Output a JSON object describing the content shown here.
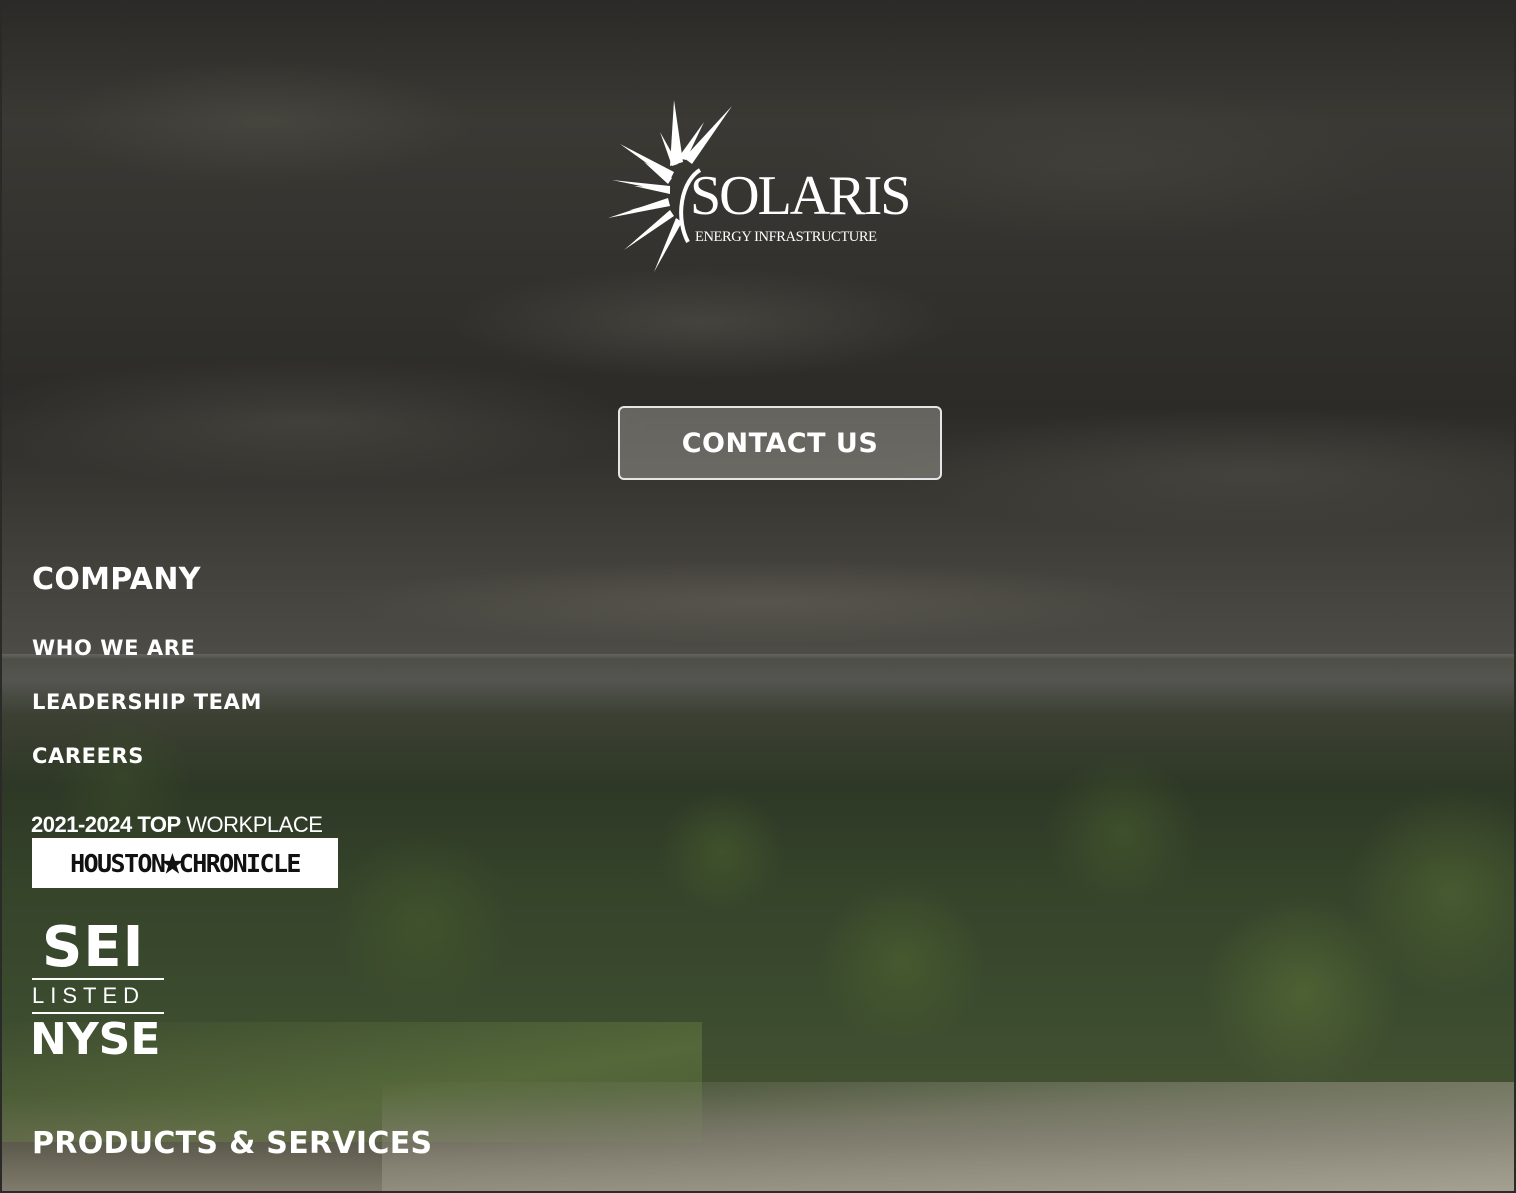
{
  "brand": {
    "name": "SOLARIS",
    "trademark": "™",
    "tagline": "ENERGY INFRASTRUCTURE"
  },
  "cta": {
    "contact_label": "CONTACT US"
  },
  "company": {
    "heading": "COMPANY",
    "links": [
      {
        "label": "WHO WE ARE"
      },
      {
        "label": "LEADERSHIP TEAM"
      },
      {
        "label": "CAREERS"
      }
    ]
  },
  "award": {
    "years": "2021-2024",
    "top": "TOP",
    "workplace": "WORKPLACE",
    "publisher_left": "HOUSTON",
    "publisher_right": "CHRONICLE"
  },
  "listing": {
    "ticker": "SEI",
    "listed": "LISTED",
    "exchange": "NYSE"
  },
  "products": {
    "heading": "PRODUCTS & SERVICES"
  }
}
